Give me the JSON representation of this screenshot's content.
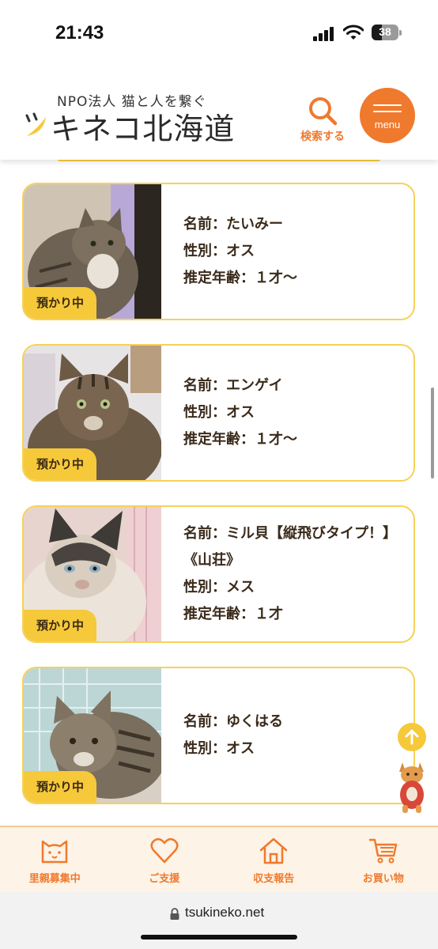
{
  "status_bar": {
    "time": "21:43",
    "battery": "38",
    "battery_level": 0.38
  },
  "header": {
    "logo_sub": "NPO法人 猫と人を繋ぐ",
    "logo_main": "キネコ北海道",
    "search_label": "検索する",
    "menu_label": "menu"
  },
  "cats": [
    {
      "name": "名前：たいみー",
      "sex": "性別：オス",
      "age": "推定年齢：１才〜",
      "status": "預かり中"
    },
    {
      "name": "名前：エンゲイ",
      "sex": "性別：オス",
      "age": "推定年齢：１才〜",
      "status": "預かり中"
    },
    {
      "name": "名前：ミル貝【縦飛びタイプ！】《山荘》",
      "sex": "性別：メス",
      "age": "推定年齢：１才",
      "status": "預かり中"
    },
    {
      "name": "名前：ゆくはる",
      "sex": "性別：オス",
      "status": "預かり中"
    }
  ],
  "bottom_nav": [
    {
      "label": "里親募集中",
      "icon": "cat-face-icon"
    },
    {
      "label": "ご支援",
      "icon": "heart-icon"
    },
    {
      "label": "収支報告",
      "icon": "house-icon"
    },
    {
      "label": "お買い物",
      "icon": "cart-icon"
    }
  ],
  "url_bar": {
    "url": "tsukineko.net"
  },
  "colors": {
    "accent": "#ef7a2e",
    "badge": "#f6c93a",
    "card_border": "#f6d158",
    "nav_bg": "#fdf3e6"
  }
}
